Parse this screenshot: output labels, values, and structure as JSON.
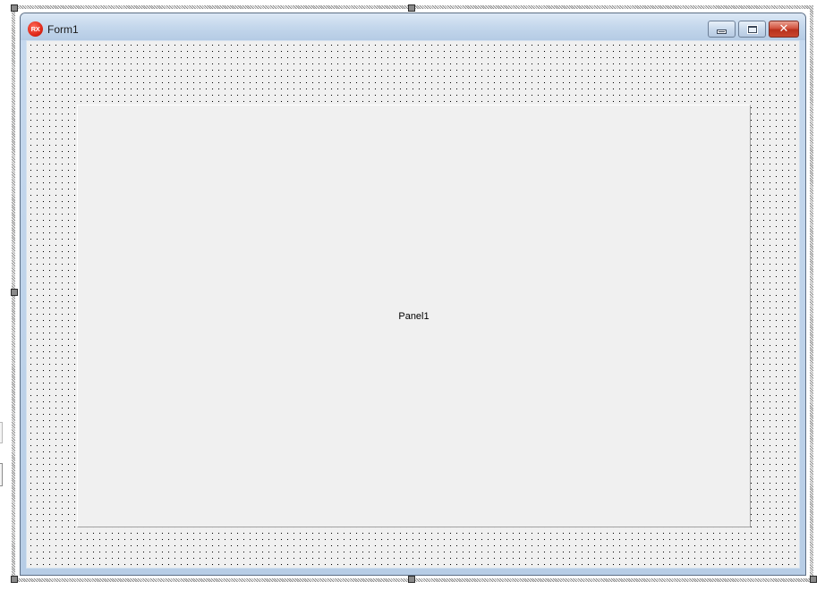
{
  "form": {
    "title": "Form1",
    "icon": "rx-app-icon",
    "icon_text": "RX",
    "caption_buttons": {
      "minimize": "minimize-icon",
      "maximize": "maximize-icon",
      "close": "close-icon",
      "close_glyph": "✕"
    }
  },
  "panel": {
    "caption": "Panel1"
  },
  "colors": {
    "title_bar": "#c4d7ec",
    "close_button": "#c8452e",
    "client_background": "#f0f0f0",
    "app_icon": "#e02a1a"
  }
}
